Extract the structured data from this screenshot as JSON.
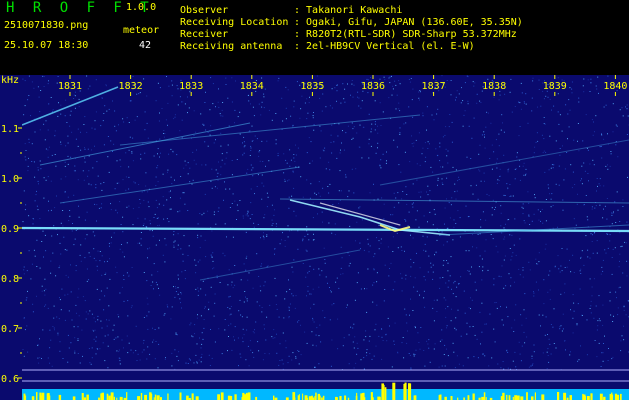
{
  "header": {
    "app_name": "H R O F F T",
    "version": "1.0.0",
    "filename": "2510071830.png",
    "datetime": "25.10.07 18:30",
    "meteor_label": "meteor",
    "meteor_count": "42",
    "info": [
      {
        "label": "Observer",
        "value": ": Takanori Kawachi"
      },
      {
        "label": "Receiving Location",
        "value": ": Ogaki, Gifu, JAPAN (136.60E, 35.35N)"
      },
      {
        "label": "Receiver",
        "value": ": R820T2(RTL-SDR) SDR-Sharp 53.372MHz"
      },
      {
        "label": "Receiving antenna",
        "value": ": 2el-HB9CV Vertical (el. E-W)"
      }
    ]
  },
  "colors": {
    "header_yellow": "#ffff00",
    "logo_green": "#00e000",
    "spectrogram_bg": "#0a0a6e",
    "tick_yellow": "#ffff00",
    "signal_cyan": "#5fd8ff",
    "bar_yellow": "#ffff00"
  },
  "chart_data": {
    "type": "heatmap",
    "ylabel": "kHz",
    "x_ticks": [
      "1831",
      "1832",
      "1833",
      "1834",
      "1835",
      "1836",
      "1837",
      "1838",
      "1839",
      "1840"
    ],
    "y_ticks": [
      "1.1",
      "1.0",
      "0.9",
      "0.8",
      "0.7",
      "0.6"
    ],
    "y_values": [
      1.1,
      1.0,
      0.9,
      0.8,
      0.7,
      0.6
    ],
    "ylim": [
      0.58,
      1.18
    ]
  }
}
